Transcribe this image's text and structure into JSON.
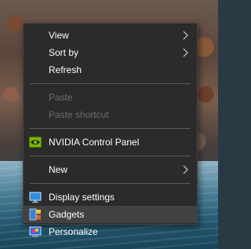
{
  "context_menu": {
    "items": [
      {
        "label": "View",
        "submenu": true
      },
      {
        "label": "Sort by",
        "submenu": true
      },
      {
        "label": "Refresh"
      },
      {
        "label": "Paste",
        "disabled": true
      },
      {
        "label": "Paste shortcut",
        "disabled": true
      },
      {
        "label": "NVIDIA Control Panel",
        "icon": "nvidia-icon"
      },
      {
        "label": "New",
        "submenu": true
      },
      {
        "label": "Display settings",
        "icon": "display-icon"
      },
      {
        "label": "Gadgets",
        "icon": "gadgets-icon",
        "highlighted": true
      },
      {
        "label": "Personalize",
        "icon": "personalize-icon"
      }
    ]
  },
  "colors": {
    "menu_background": "#2b2b2b",
    "menu_text": "#ffffff",
    "disabled_text": "#6d6d6d",
    "highlight": "#414141",
    "separator": "#5b5b5b",
    "nvidia_green": "#76b900"
  }
}
